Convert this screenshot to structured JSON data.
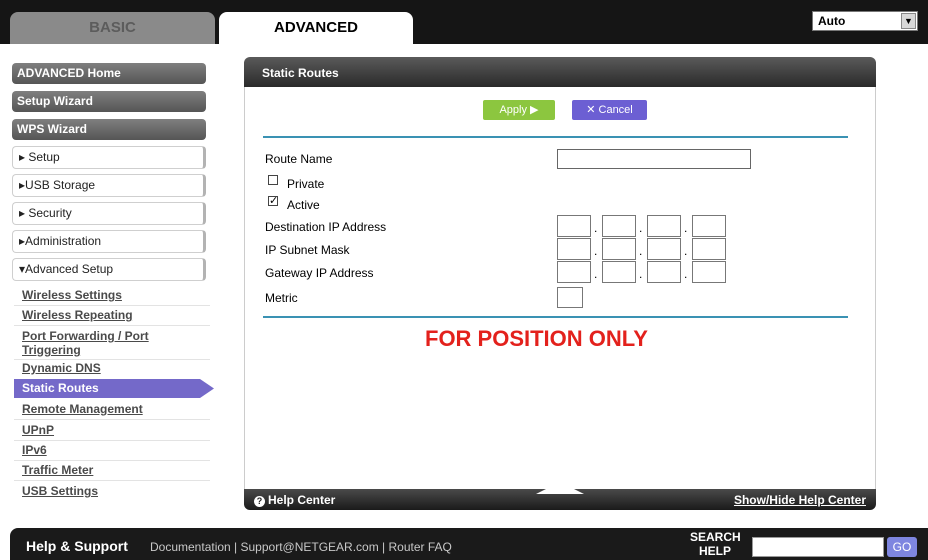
{
  "tabs": {
    "basic": "BASIC",
    "advanced": "ADVANCED"
  },
  "language": {
    "selected": "Auto",
    "arrow": "▼"
  },
  "sidebar": {
    "top_items": [
      "ADVANCED Home",
      "Setup Wizard",
      "WPS Wizard"
    ],
    "sections": [
      "▸ Setup",
      "▸USB Storage",
      "▸ Security",
      "▸Administration",
      "▾Advanced Setup"
    ],
    "sub_items": [
      "Wireless Settings",
      "Wireless Repeating",
      "Port Forwarding / Port",
      "Triggering",
      "Dynamic DNS",
      "Static Routes",
      "Remote Management",
      "UPnP",
      "IPv6",
      "Traffic Meter",
      "USB Settings"
    ]
  },
  "panel": {
    "title": "Static Routes",
    "apply": "Apply ▶",
    "cancel": "✕ Cancel",
    "fields": {
      "route_name": "Route Name",
      "private": "Private",
      "active": "Active",
      "dest_ip": "Destination IP Address",
      "subnet": "IP Subnet Mask",
      "gateway": "Gateway IP Address",
      "metric": "Metric"
    },
    "checks": {
      "private": "",
      "active": "✓"
    },
    "dot": ".",
    "fpo": "FOR POSITION ONLY"
  },
  "help": {
    "center": "Help Center",
    "toggle": "Show/Hide Help Center",
    "icon": "?"
  },
  "footer": {
    "title": "Help & Support",
    "links": "Documentation | Support@NETGEAR.com | Router FAQ",
    "search_label": "SEARCH HELP",
    "go": "GO"
  },
  "colors": {
    "accent_line": "#3a92b3",
    "apply": "#8cc63f",
    "cancel": "#6c5fd3",
    "active_nav": "#7469c9",
    "fpo": "#e3211c"
  }
}
